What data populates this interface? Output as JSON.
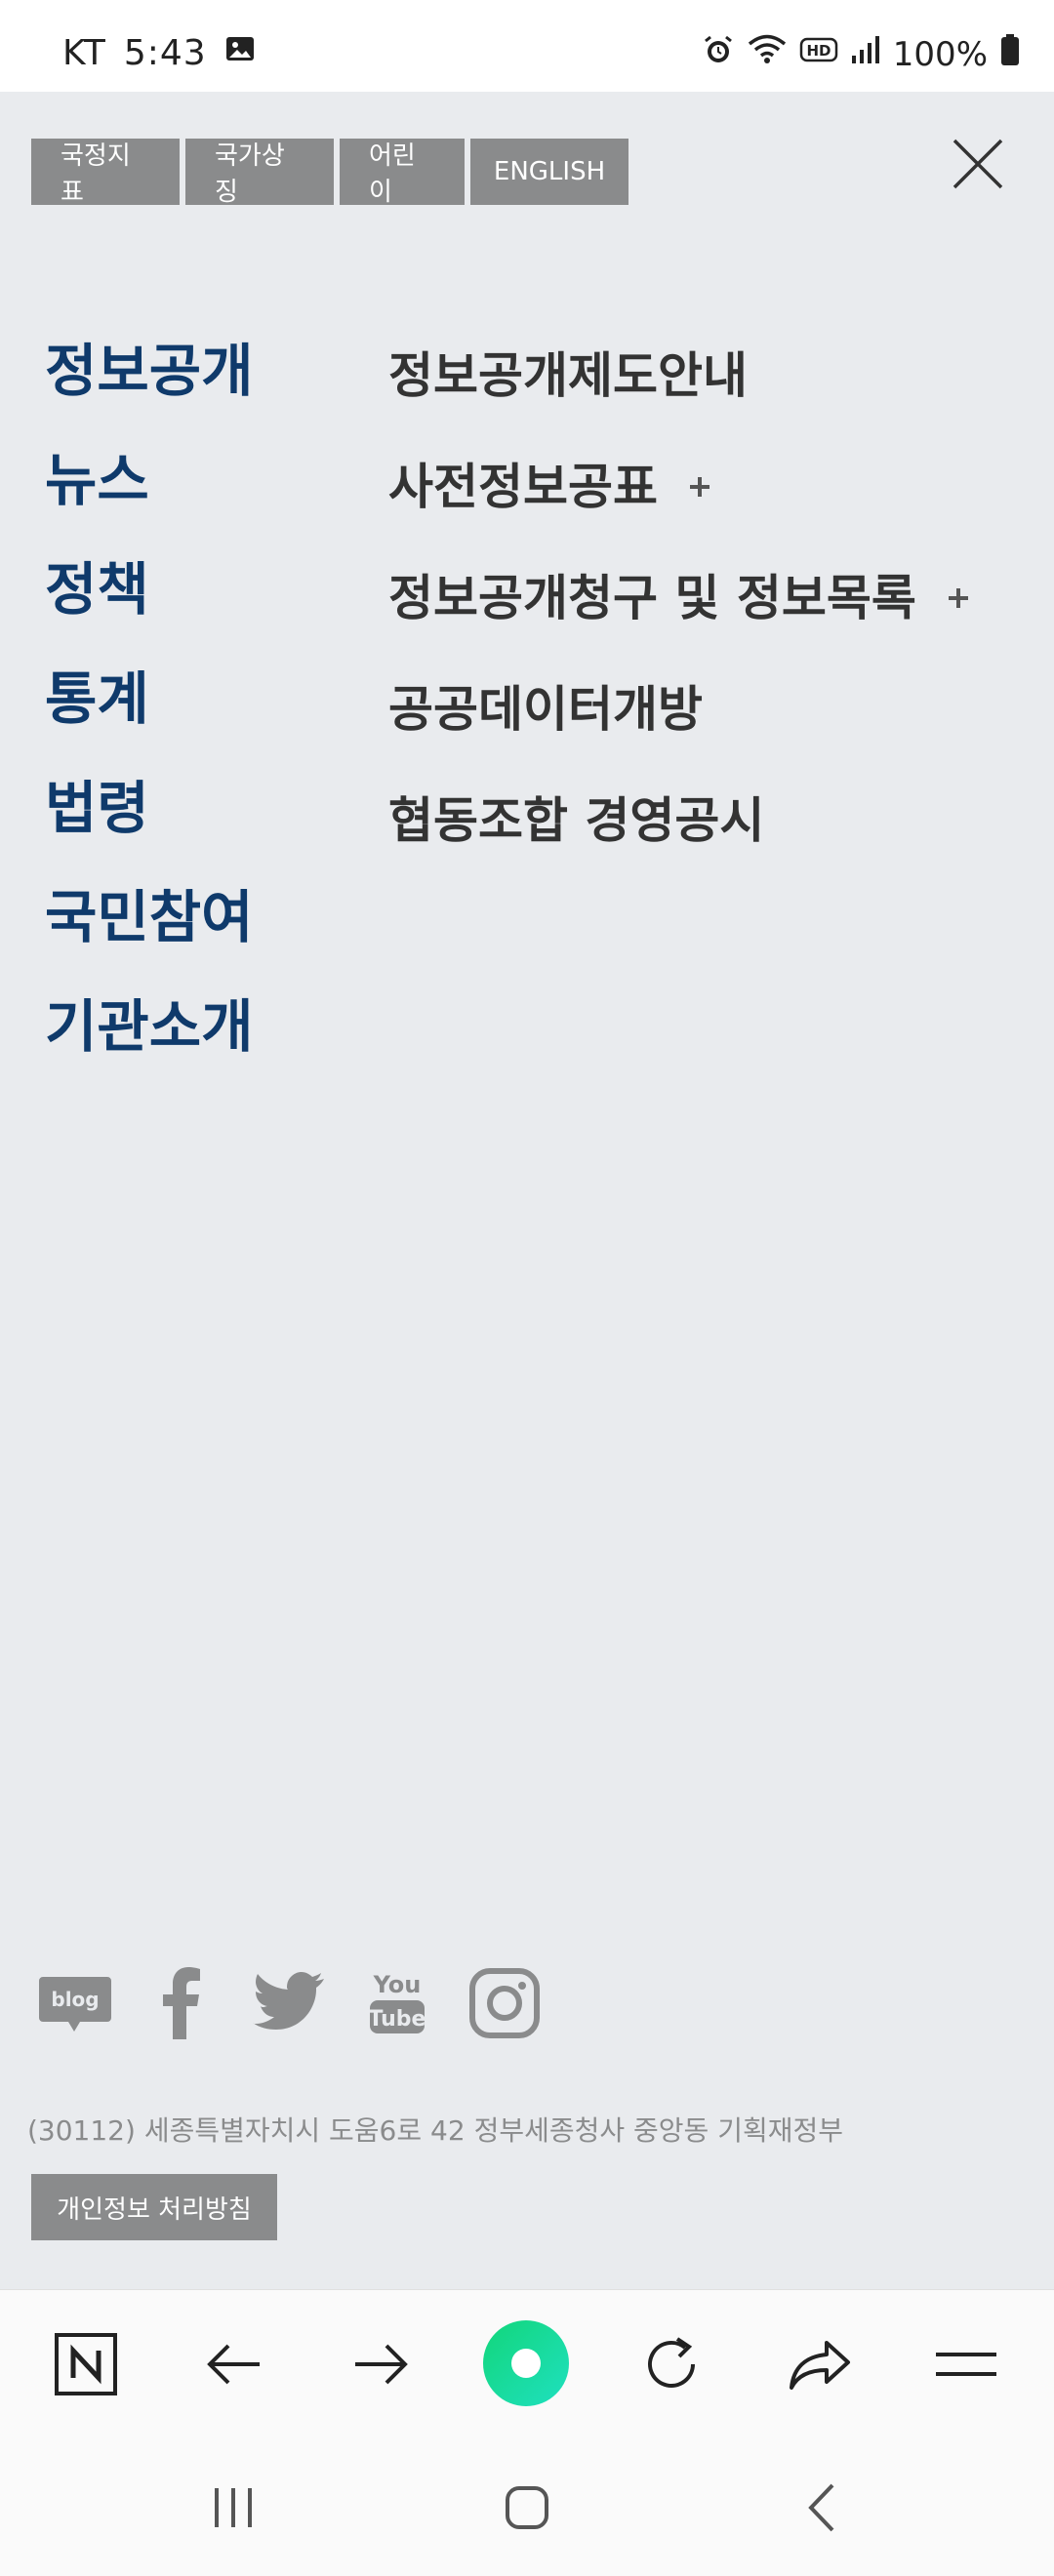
{
  "status_bar": {
    "carrier": "KT",
    "time": "5:43",
    "battery": "100%",
    "icons": [
      "image-icon",
      "alarm-icon",
      "wifi-icon",
      "hd-icon",
      "signal-icon",
      "battery-icon"
    ]
  },
  "top_tabs": [
    "국정지표",
    "국가상징",
    "어린이",
    "ENGLISH"
  ],
  "primary_menu": [
    "정보공개",
    "뉴스",
    "정책",
    "통계",
    "법령",
    "국민참여",
    "기관소개"
  ],
  "secondary_menu": [
    {
      "label": "정보공개제도안내",
      "expandable": false
    },
    {
      "label": "사전정보공표",
      "expandable": true
    },
    {
      "label": "정보공개청구 및 정보목록",
      "expandable": true
    },
    {
      "label": "공공데이터개방",
      "expandable": false
    },
    {
      "label": "협동조합 경영공시",
      "expandable": false
    }
  ],
  "social": [
    "blog-icon",
    "facebook-icon",
    "twitter-icon",
    "youtube-icon",
    "instagram-icon"
  ],
  "footer": {
    "address": "(30112) 세종특별자치시 도움6로 42 정부세종청사 중앙동 기획재정부",
    "privacy_label": "개인정보 처리방침"
  },
  "colors": {
    "primary_menu": "#0f3a6b",
    "secondary_menu": "#333333",
    "tab_bg": "#8a8b8c",
    "panel_bg": "#e9ebee",
    "accent_green": "#1fd38a"
  },
  "browser_bar": [
    "naver-home-icon",
    "back-arrow-icon",
    "forward-arrow-icon",
    "green-dot-icon",
    "refresh-icon",
    "share-icon",
    "menu-icon"
  ],
  "nav_bar": [
    "recent-apps-icon",
    "home-icon",
    "back-icon"
  ]
}
